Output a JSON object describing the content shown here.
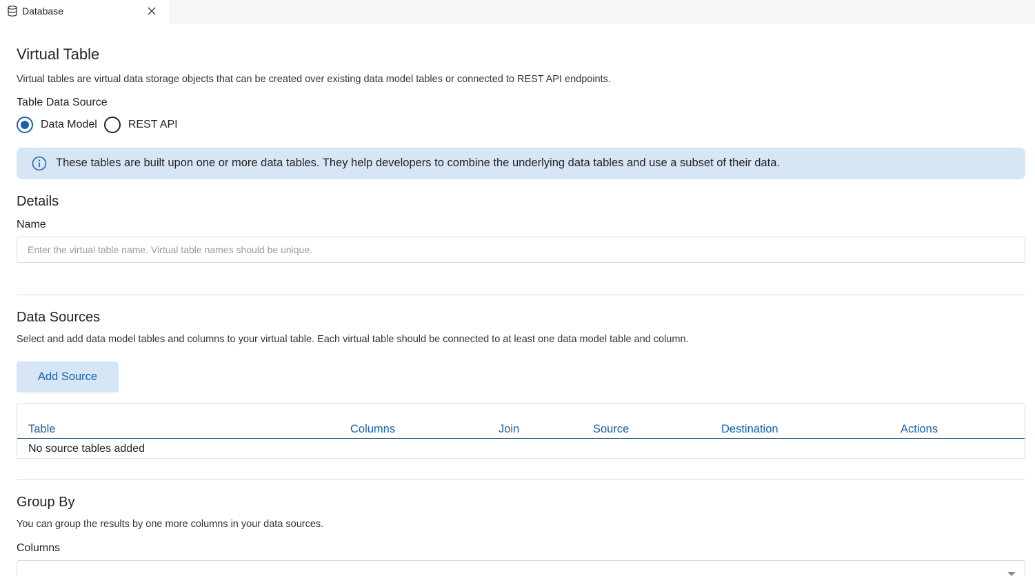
{
  "tab": {
    "label": "Database",
    "icon": "database-icon",
    "close_icon": "close-icon"
  },
  "page": {
    "title": "Virtual Table",
    "description": "Virtual tables are virtual data storage objects that can be created over existing data model tables or connected to REST API endpoints."
  },
  "data_source": {
    "label": "Table Data Source",
    "options": [
      {
        "label": "Data Model",
        "selected": true
      },
      {
        "label": "REST API",
        "selected": false
      }
    ]
  },
  "info_banner": {
    "icon": "info-icon",
    "text": "These tables are built upon one or more data tables. They help developers to combine the underlying data tables and use a subset of their data."
  },
  "details": {
    "heading": "Details",
    "name_label": "Name",
    "name_value": "",
    "name_placeholder": "Enter the virtual table name. Virtual table names should be unique."
  },
  "data_sources": {
    "heading": "Data Sources",
    "description": "Select and add data model tables and columns to your virtual table. Each virtual table should be connected to at least one data model table and column.",
    "add_button": "Add Source",
    "columns": [
      "Table",
      "Columns",
      "Join",
      "Source",
      "Destination",
      "Actions"
    ],
    "empty_text": "No source tables added"
  },
  "group_by": {
    "heading": "Group By",
    "description": "You can group the results by one more columns in your data sources.",
    "columns_label": "Columns"
  },
  "colors": {
    "accent": "#1a5fa8",
    "banner": "#d6e6f5",
    "header_rule": "#1c4f70"
  }
}
